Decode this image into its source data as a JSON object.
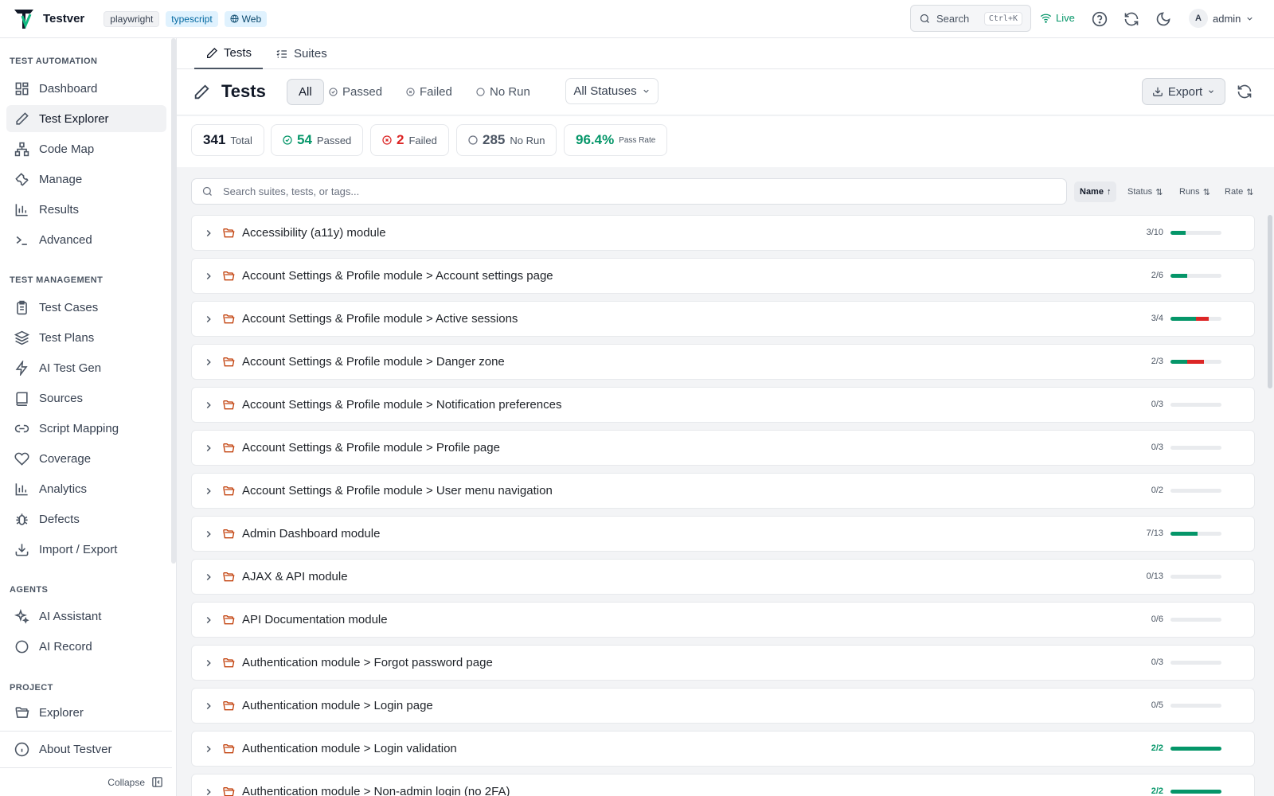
{
  "app": {
    "name": "Testver",
    "tags": [
      "playwright",
      "typescript"
    ],
    "platform": "Web"
  },
  "topbar": {
    "search_label": "Search",
    "search_shortcut": "Ctrl+K",
    "live_label": "Live",
    "user_initial": "A",
    "user_name": "admin"
  },
  "sidebar": {
    "sections": [
      {
        "title": "TEST AUTOMATION",
        "items": [
          "Dashboard",
          "Test Explorer",
          "Code Map",
          "Manage",
          "Results",
          "Advanced"
        ]
      },
      {
        "title": "TEST MANAGEMENT",
        "items": [
          "Test Cases",
          "Test Plans",
          "AI Test Gen",
          "Sources",
          "Script Mapping",
          "Coverage",
          "Analytics",
          "Defects",
          "Import / Export"
        ]
      },
      {
        "title": "AGENTS",
        "items": [
          "AI Assistant",
          "AI Record"
        ]
      },
      {
        "title": "PROJECT",
        "items": [
          "Explorer"
        ]
      }
    ],
    "active_item": "Test Explorer",
    "footer_item": "About Testver",
    "collapse_label": "Collapse"
  },
  "tabs": [
    {
      "label": "Tests",
      "active": true
    },
    {
      "label": "Suites",
      "active": false
    }
  ],
  "header": {
    "title": "Tests",
    "filters": [
      {
        "label": "All",
        "selected": true
      },
      {
        "label": "Passed",
        "selected": false
      },
      {
        "label": "Failed",
        "selected": false
      },
      {
        "label": "No Run",
        "selected": false
      }
    ],
    "status_dropdown": "All Statuses",
    "export_label": "Export"
  },
  "stats": {
    "total": {
      "value": "341",
      "label": "Total"
    },
    "passed": {
      "value": "54",
      "label": "Passed"
    },
    "failed": {
      "value": "2",
      "label": "Failed"
    },
    "no_run": {
      "value": "285",
      "label": "No Run"
    },
    "pass_rate": {
      "value": "96.4%",
      "label": "Pass Rate"
    }
  },
  "search": {
    "placeholder": "Search suites, tests, or tags...",
    "value": ""
  },
  "sort_options": [
    {
      "label": "Name",
      "active": true,
      "arrow": "↑"
    },
    {
      "label": "Status",
      "active": false,
      "arrow": "⇅"
    },
    {
      "label": "Runs",
      "active": false,
      "arrow": "⇅"
    },
    {
      "label": "Rate",
      "active": false,
      "arrow": "⇅"
    }
  ],
  "colors": {
    "pass": "#059669",
    "fail": "#dc2626",
    "folder": "#c2410c"
  },
  "suites": [
    {
      "name": "Accessibility (a11y) module",
      "passed": 3,
      "failed": 0,
      "total": 10
    },
    {
      "name": "Account Settings & Profile module > Account settings page",
      "passed": 2,
      "failed": 0,
      "total": 6
    },
    {
      "name": "Account Settings & Profile module > Active sessions",
      "passed": 3,
      "failed": 1,
      "total": 4
    },
    {
      "name": "Account Settings & Profile module > Danger zone",
      "passed": 2,
      "failed": 1,
      "total": 3
    },
    {
      "name": "Account Settings & Profile module > Notification preferences",
      "passed": 0,
      "failed": 0,
      "total": 3
    },
    {
      "name": "Account Settings & Profile module > Profile page",
      "passed": 0,
      "failed": 0,
      "total": 3
    },
    {
      "name": "Account Settings & Profile module > User menu navigation",
      "passed": 0,
      "failed": 0,
      "total": 2
    },
    {
      "name": "Admin Dashboard module",
      "passed": 7,
      "failed": 0,
      "total": 13
    },
    {
      "name": "AJAX & API module",
      "passed": 0,
      "failed": 0,
      "total": 13
    },
    {
      "name": "API Documentation module",
      "passed": 0,
      "failed": 0,
      "total": 6
    },
    {
      "name": "Authentication module > Forgot password page",
      "passed": 0,
      "failed": 0,
      "total": 3
    },
    {
      "name": "Authentication module > Login page",
      "passed": 0,
      "failed": 0,
      "total": 5
    },
    {
      "name": "Authentication module > Login validation",
      "passed": 2,
      "failed": 0,
      "total": 2
    },
    {
      "name": "Authentication module > Non-admin login (no 2FA)",
      "passed": 2,
      "failed": 0,
      "total": 2
    }
  ]
}
